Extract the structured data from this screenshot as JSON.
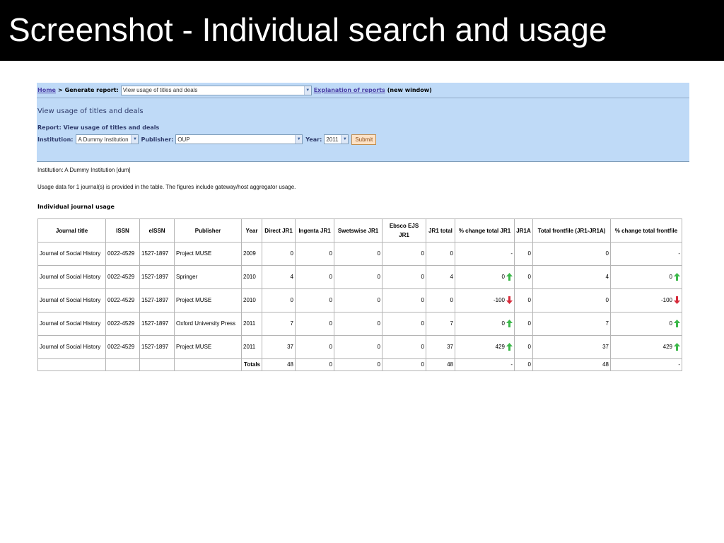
{
  "slide": {
    "title": "Screenshot - Individual search and usage"
  },
  "breadcrumb": {
    "home": "Home",
    "separator": ">",
    "generate_label": "Generate report:",
    "report_select": "View usage of titles and deals",
    "explanation_link": "Explanation of reports",
    "new_window": "(new window)"
  },
  "panel": {
    "heading": "View usage of titles and deals",
    "report_line": "Report:  View usage of titles and deals",
    "institution_label": "Institution:",
    "institution_value": "A Dummy Institution",
    "publisher_label": "Publisher:",
    "publisher_value": "OUP",
    "year_label": "Year:",
    "year_value": "2011",
    "submit_label": "Submit"
  },
  "info": {
    "institution_line": "Institution: A Dummy Institution [dum]",
    "usage_line": "Usage data for 1 journal(s) is provided in the table. The figures include gateway/host aggregator usage."
  },
  "section_title": "Individual journal usage",
  "table": {
    "headers": [
      "Journal title",
      "ISSN",
      "eISSN",
      "Publisher",
      "Year",
      "Direct JR1",
      "Ingenta JR1",
      "Swetswise JR1",
      "Ebsco EJS JR1",
      "JR1 total",
      "% change total JR1",
      "JR1A",
      "Total frontfile (JR1-JR1A)",
      "% change total frontfile"
    ],
    "rows": [
      {
        "title": "Journal of Social History",
        "issn": "0022-4529",
        "eissn": "1527-1897",
        "publisher": "Project MUSE",
        "year": "2009",
        "direct": "0",
        "ingenta": "0",
        "swetswise": "0",
        "ebsco": "0",
        "jr1_total": "0",
        "pct_jr1": "-",
        "pct_jr1_dir": "none",
        "jr1a": "0",
        "frontfile": "0",
        "pct_front": "-",
        "pct_front_dir": "none"
      },
      {
        "title": "Journal of Social History",
        "issn": "0022-4529",
        "eissn": "1527-1897",
        "publisher": "Springer",
        "year": "2010",
        "direct": "4",
        "ingenta": "0",
        "swetswise": "0",
        "ebsco": "0",
        "jr1_total": "4",
        "pct_jr1": "0",
        "pct_jr1_dir": "up",
        "jr1a": "0",
        "frontfile": "4",
        "pct_front": "0",
        "pct_front_dir": "up"
      },
      {
        "title": "Journal of Social History",
        "issn": "0022-4529",
        "eissn": "1527-1897",
        "publisher": "Project MUSE",
        "year": "2010",
        "direct": "0",
        "ingenta": "0",
        "swetswise": "0",
        "ebsco": "0",
        "jr1_total": "0",
        "pct_jr1": "-100",
        "pct_jr1_dir": "down",
        "jr1a": "0",
        "frontfile": "0",
        "pct_front": "-100",
        "pct_front_dir": "down"
      },
      {
        "title": "Journal of Social History",
        "issn": "0022-4529",
        "eissn": "1527-1897",
        "publisher": "Oxford University Press",
        "year": "2011",
        "direct": "7",
        "ingenta": "0",
        "swetswise": "0",
        "ebsco": "0",
        "jr1_total": "7",
        "pct_jr1": "0",
        "pct_jr1_dir": "up",
        "jr1a": "0",
        "frontfile": "7",
        "pct_front": "0",
        "pct_front_dir": "up"
      },
      {
        "title": "Journal of Social History",
        "issn": "0022-4529",
        "eissn": "1527-1897",
        "publisher": "Project MUSE",
        "year": "2011",
        "direct": "37",
        "ingenta": "0",
        "swetswise": "0",
        "ebsco": "0",
        "jr1_total": "37",
        "pct_jr1": "429",
        "pct_jr1_dir": "up",
        "jr1a": "0",
        "frontfile": "37",
        "pct_front": "429",
        "pct_front_dir": "up"
      }
    ],
    "totals": {
      "label": "Totals",
      "direct": "48",
      "ingenta": "0",
      "swetswise": "0",
      "ebsco": "0",
      "jr1_total": "48",
      "pct_jr1": "-",
      "jr1a": "0",
      "frontfile": "48",
      "pct_front": "-"
    }
  },
  "colors": {
    "panel_bg": "#bfdaf7",
    "link": "#4b3fa6",
    "arrow_up": "#3cb84a",
    "arrow_down": "#d62a3a"
  }
}
